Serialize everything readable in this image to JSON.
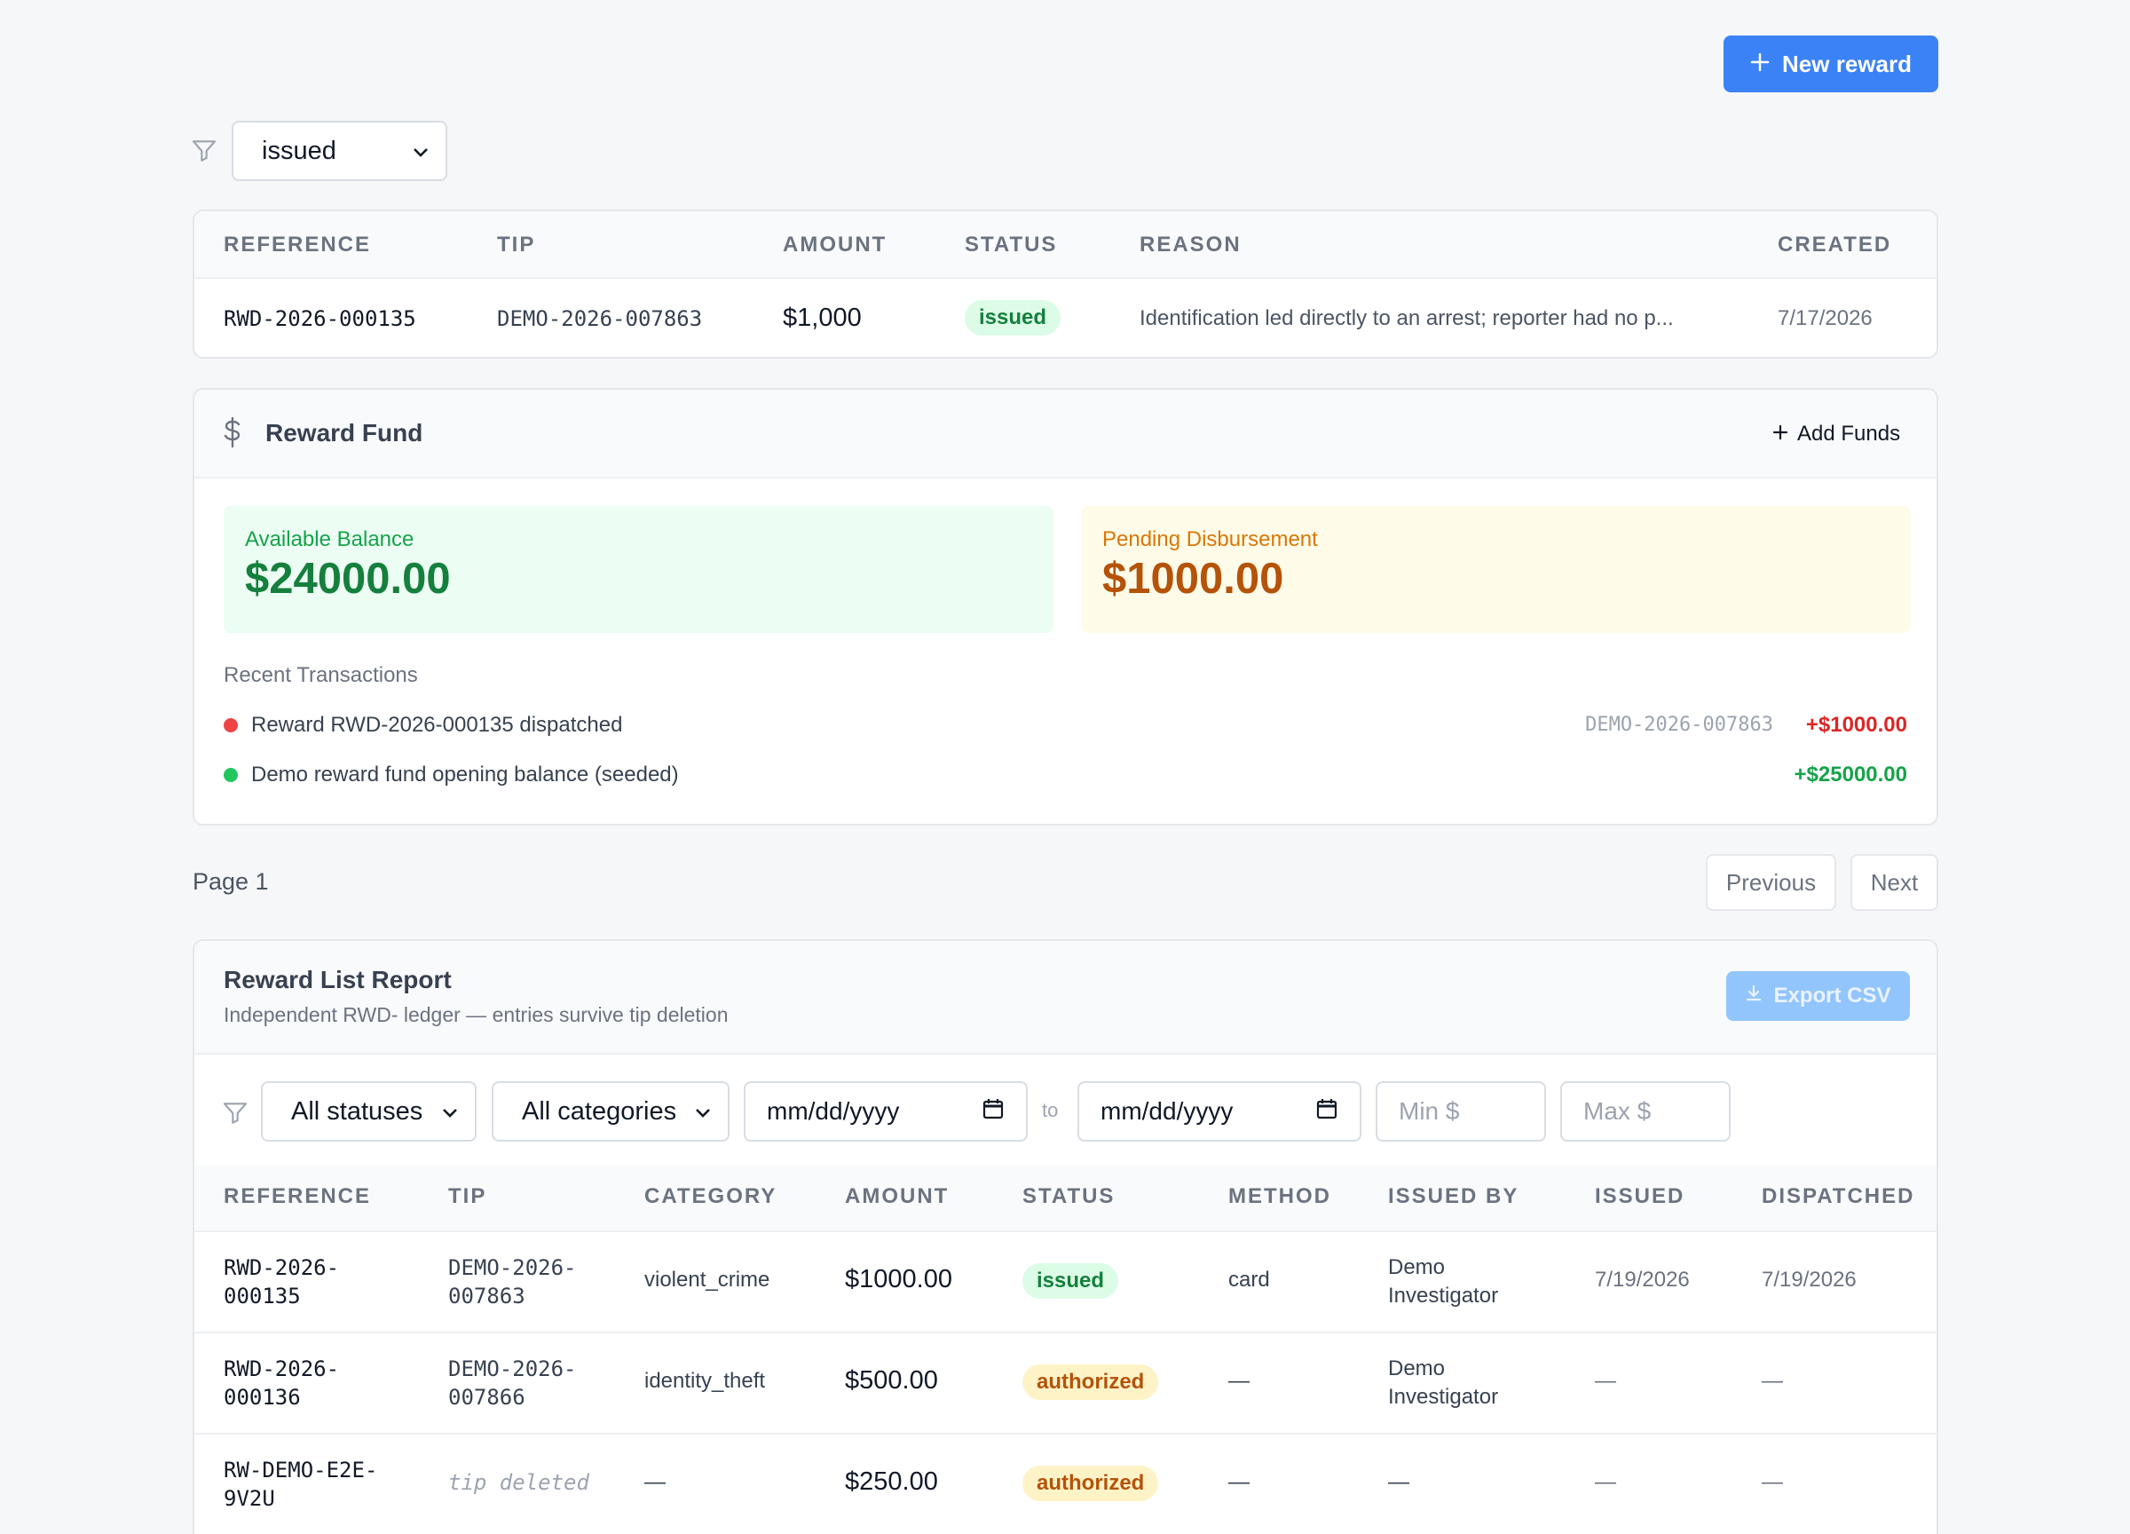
{
  "toolbar": {
    "new_reward_label": "New reward"
  },
  "filter": {
    "status_value": "issued"
  },
  "rewards_table": {
    "headers": [
      "REFERENCE",
      "TIP",
      "AMOUNT",
      "STATUS",
      "REASON",
      "CREATED"
    ],
    "rows": [
      {
        "reference": "RWD-2026-000135",
        "tip": "DEMO-2026-007863",
        "amount": "$1,000",
        "status": "issued",
        "reason": "Identification led directly to an arrest; reporter had no p...",
        "created": "7/17/2026"
      }
    ]
  },
  "fund": {
    "title": "Reward Fund",
    "add_funds_label": "Add Funds",
    "available_label": "Available Balance",
    "available_value": "$24000.00",
    "pending_label": "Pending Disbursement",
    "pending_value": "$1000.00",
    "recent_label": "Recent Transactions",
    "transactions": [
      {
        "description": "Reward RWD-2026-000135 dispatched",
        "ref": "DEMO-2026-007863",
        "amount": "+$1000.00",
        "color": "#ef4444"
      },
      {
        "description": "Demo reward fund opening balance (seeded)",
        "ref": "",
        "amount": "+$25000.00",
        "color": "#22c55e"
      }
    ]
  },
  "pagination": {
    "page_label": "Page 1",
    "previous_label": "Previous",
    "next_label": "Next"
  },
  "report": {
    "title": "Reward List Report",
    "subtitle": "Independent RWD- ledger — entries survive tip deletion",
    "export_label": "Export CSV",
    "filters": {
      "status": "All statuses",
      "category": "All categories",
      "date_from": "mm/dd/yyyy",
      "to_label": "to",
      "date_to": "mm/dd/yyyy",
      "min_placeholder": "Min $",
      "max_placeholder": "Max $"
    },
    "headers": [
      "REFERENCE",
      "TIP",
      "CATEGORY",
      "AMOUNT",
      "STATUS",
      "METHOD",
      "ISSUED BY",
      "ISSUED",
      "DISPATCHED"
    ],
    "rows": [
      {
        "ref1": "RWD-2026-",
        "ref2": "000135",
        "tip1": "DEMO-2026-",
        "tip2": "007863",
        "category": "violent_crime",
        "amount": "$1000.00",
        "status": "issued",
        "method": "card",
        "by1": "Demo",
        "by2": "Investigator",
        "issued": "7/19/2026",
        "dispatched": "7/19/2026"
      },
      {
        "ref1": "RWD-2026-",
        "ref2": "000136",
        "tip1": "DEMO-2026-",
        "tip2": "007866",
        "category": "identity_theft",
        "amount": "$500.00",
        "status": "authorized",
        "method": "—",
        "by1": "Demo",
        "by2": "Investigator",
        "issued": "—",
        "dispatched": "—"
      },
      {
        "ref1": "RW-DEMO-E2E-",
        "ref2": "9V2U",
        "tip_deleted": "tip deleted",
        "category": "—",
        "amount": "$250.00",
        "status": "authorized",
        "method": "—",
        "by": "—",
        "issued": "—",
        "dispatched": "—"
      }
    ]
  },
  "colors": {
    "accent": "#3b82f6",
    "success": "#15803d",
    "warning": "#b45309",
    "danger": "#dc2626"
  }
}
